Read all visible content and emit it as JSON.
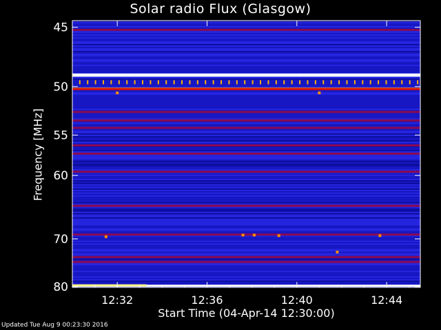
{
  "chart_data": {
    "type": "heatmap",
    "title": "Solar radio Flux (Glasgow)",
    "xlabel": "Start Time (04-Apr-14 12:30:00)",
    "ylabel": "Frequency [MHz]",
    "x_unit": "minutes after 12:30:00",
    "xlim": [
      0,
      15.5
    ],
    "ylim": [
      44.5,
      80.2
    ],
    "y_scale": "reciprocal",
    "x_ticks": [
      {
        "value": 2,
        "label": "12:32"
      },
      {
        "value": 6,
        "label": "12:36"
      },
      {
        "value": 10,
        "label": "12:40"
      },
      {
        "value": 14,
        "label": "12:44"
      }
    ],
    "y_ticks": [
      {
        "value": 45,
        "label": "45"
      },
      {
        "value": 50,
        "label": "50"
      },
      {
        "value": 55,
        "label": "55"
      },
      {
        "value": 60,
        "label": "60"
      },
      {
        "value": 70,
        "label": "70"
      },
      {
        "value": 80,
        "label": "80"
      }
    ],
    "colormap": [
      "#000033",
      "#0a0a8c",
      "#1a1acc",
      "#3333ff",
      "#8b0a50",
      "#d01010",
      "#ff8c00",
      "#ffff80",
      "#ffffff"
    ],
    "bands": [
      {
        "freq": 45.2,
        "intensity": 0.5
      },
      {
        "freq": 48.9,
        "intensity": 1.0
      },
      {
        "freq": 49.0,
        "intensity": 0.95
      },
      {
        "freq": 50.2,
        "intensity": 0.7
      },
      {
        "freq": 50.25,
        "intensity": 0.65
      },
      {
        "freq": 52.5,
        "intensity": 0.55
      },
      {
        "freq": 53.4,
        "intensity": 0.5
      },
      {
        "freq": 54.2,
        "intensity": 0.48
      },
      {
        "freq": 56.2,
        "intensity": 0.5
      },
      {
        "freq": 57.2,
        "intensity": 0.47
      },
      {
        "freq": 59.5,
        "intensity": 0.55
      },
      {
        "freq": 64.4,
        "intensity": 0.45
      },
      {
        "freq": 69.2,
        "intensity": 0.5
      },
      {
        "freq": 73.5,
        "intensity": 0.5
      },
      {
        "freq": 74.5,
        "intensity": 0.45
      },
      {
        "freq": 79.8,
        "intensity": 0.95
      }
    ],
    "spikes": [
      {
        "time": 2.0,
        "freq": 50.6
      },
      {
        "time": 11.0,
        "freq": 50.6
      },
      {
        "time": 1.5,
        "freq": 69.6
      },
      {
        "time": 7.6,
        "freq": 69.3
      },
      {
        "time": 8.1,
        "freq": 69.3
      },
      {
        "time": 9.2,
        "freq": 69.4
      },
      {
        "time": 11.8,
        "freq": 72.5
      },
      {
        "time": 13.7,
        "freq": 69.4
      }
    ]
  },
  "footer": "Updated Tue Aug  9 00:23:30 2016"
}
